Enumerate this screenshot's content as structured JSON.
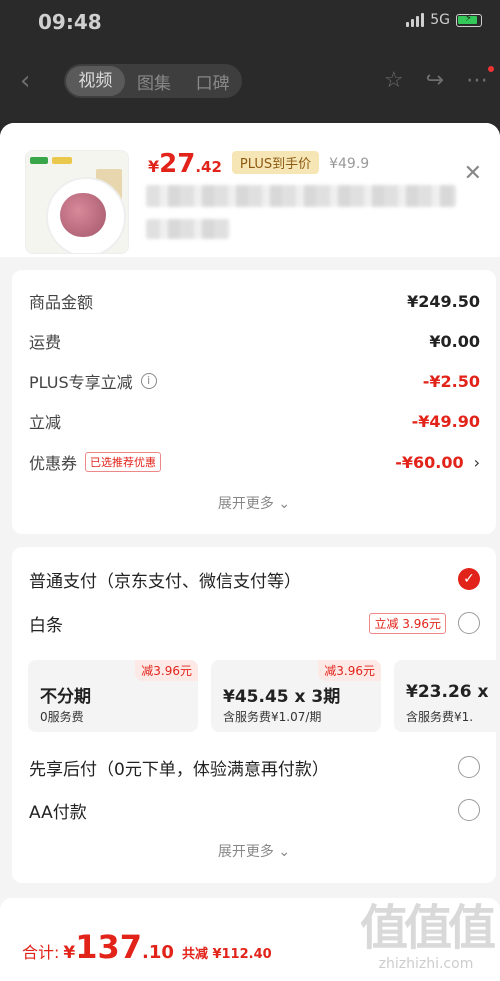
{
  "status": {
    "time": "09:48",
    "network": "5G"
  },
  "nav": {
    "tabs": [
      {
        "label": "视频",
        "active": true
      },
      {
        "label": "图集",
        "active": false
      },
      {
        "label": "口碑",
        "active": false
      }
    ]
  },
  "product": {
    "price_yen": "¥",
    "price_int": "27",
    "price_dec": ".42",
    "plus_tag": "PLUS到手价",
    "orig_price": "¥49.9"
  },
  "summary": {
    "goods_label": "商品金额",
    "goods_value": "¥249.50",
    "shipping_label": "运费",
    "shipping_value": "¥0.00",
    "plus_label": "PLUS专享立减",
    "plus_value": "-¥2.50",
    "discount_label": "立减",
    "discount_value": "-¥49.90",
    "coupon_label": "优惠券",
    "coupon_tag": "已选推荐优惠",
    "coupon_value": "-¥60.00",
    "more_label": "展开更多"
  },
  "payment": {
    "normal_label": "普通支付（京东支付、微信支付等）",
    "baitiao_label": "白条",
    "baitiao_tag": "立减 3.96元",
    "plans": [
      {
        "badge": "减3.96元",
        "title": "不分期",
        "sub": "0服务费"
      },
      {
        "badge": "减3.96元",
        "title": "¥45.45 x 3期",
        "sub": "含服务费¥1.07/期"
      },
      {
        "badge": "",
        "title": "¥23.26 x",
        "sub": "含服务费¥1."
      }
    ],
    "later_label": "先享后付（0元下单，体验满意再付款）",
    "aa_label": "AA付款",
    "more_label": "展开更多"
  },
  "bottom": {
    "total_label": "合计:",
    "yen": "¥",
    "int": "137",
    "dec": ".10",
    "saved": "共减 ¥112.40"
  },
  "watermark": {
    "big": "值值值",
    "small": "zhizhizhi.com"
  },
  "colors": {
    "accent": "#e2231a",
    "plus_bg": "#f7e6b5"
  }
}
